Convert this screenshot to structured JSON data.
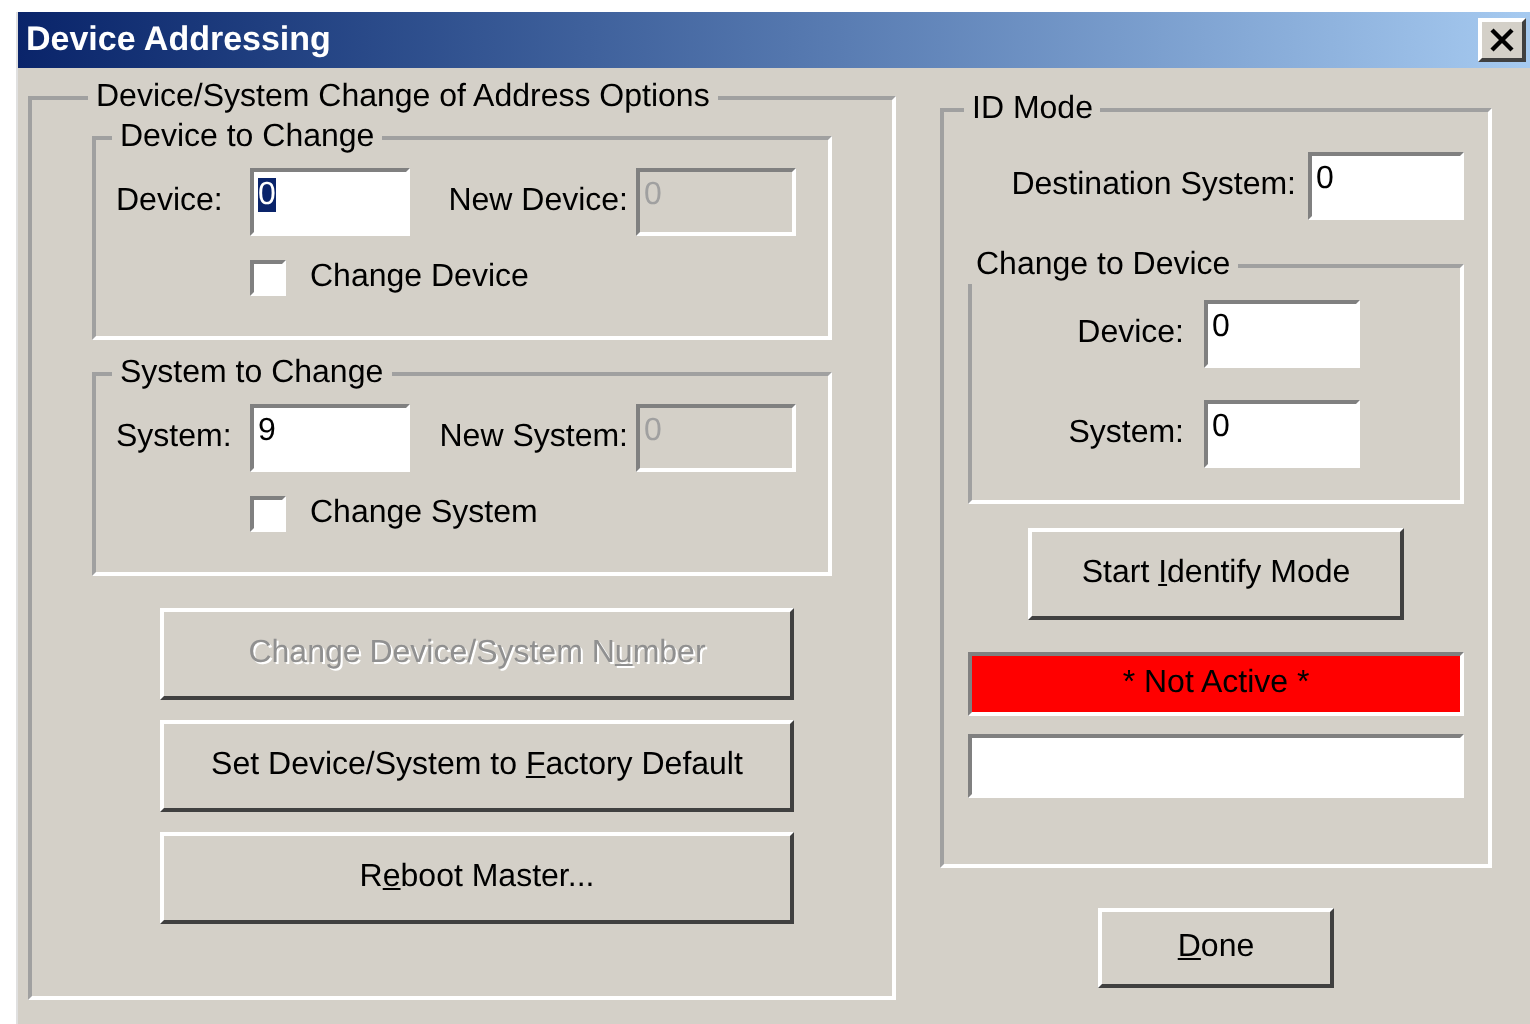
{
  "window": {
    "title": "Device Addressing"
  },
  "address_options": {
    "title": "Device/System Change of Address Options",
    "groups": [
      {
        "title": "Device to Change",
        "field": {
          "label": "Device:",
          "value": "0",
          "text_selected": true
        },
        "new_field": {
          "label": "New Device:",
          "value": "0",
          "disabled": true
        },
        "checkbox": {
          "label": "Change Device",
          "checked": false
        }
      },
      {
        "title": "System to Change",
        "field": {
          "label": "System:",
          "value": "9",
          "text_selected": false
        },
        "new_field": {
          "label": "New System:",
          "value": "0",
          "disabled": true
        },
        "checkbox": {
          "label": "Change System",
          "checked": false
        }
      }
    ],
    "buttons": [
      {
        "pre": "Change Device/System N",
        "key": "u",
        "post": "mber",
        "disabled": true
      },
      {
        "pre": "Set Device/System to ",
        "key": "F",
        "post": "actory Default",
        "disabled": false
      },
      {
        "pre": "R",
        "key": "e",
        "post": "boot Master...",
        "disabled": false
      }
    ]
  },
  "id_mode": {
    "title": "ID Mode",
    "destination": {
      "label": "Destination System:",
      "value": "0"
    },
    "change_to_device": {
      "title": "Change to Device",
      "fields": [
        {
          "label": "Device:",
          "value": "0"
        },
        {
          "label": "System:",
          "value": "0"
        }
      ]
    },
    "button": {
      "pre": "Start ",
      "key": "I",
      "post": "dentify Mode",
      "disabled": false
    },
    "status": {
      "text": "* Not Active *",
      "color": "#ff0000"
    }
  },
  "done_button": {
    "key": "D",
    "post": "one",
    "disabled": false
  }
}
